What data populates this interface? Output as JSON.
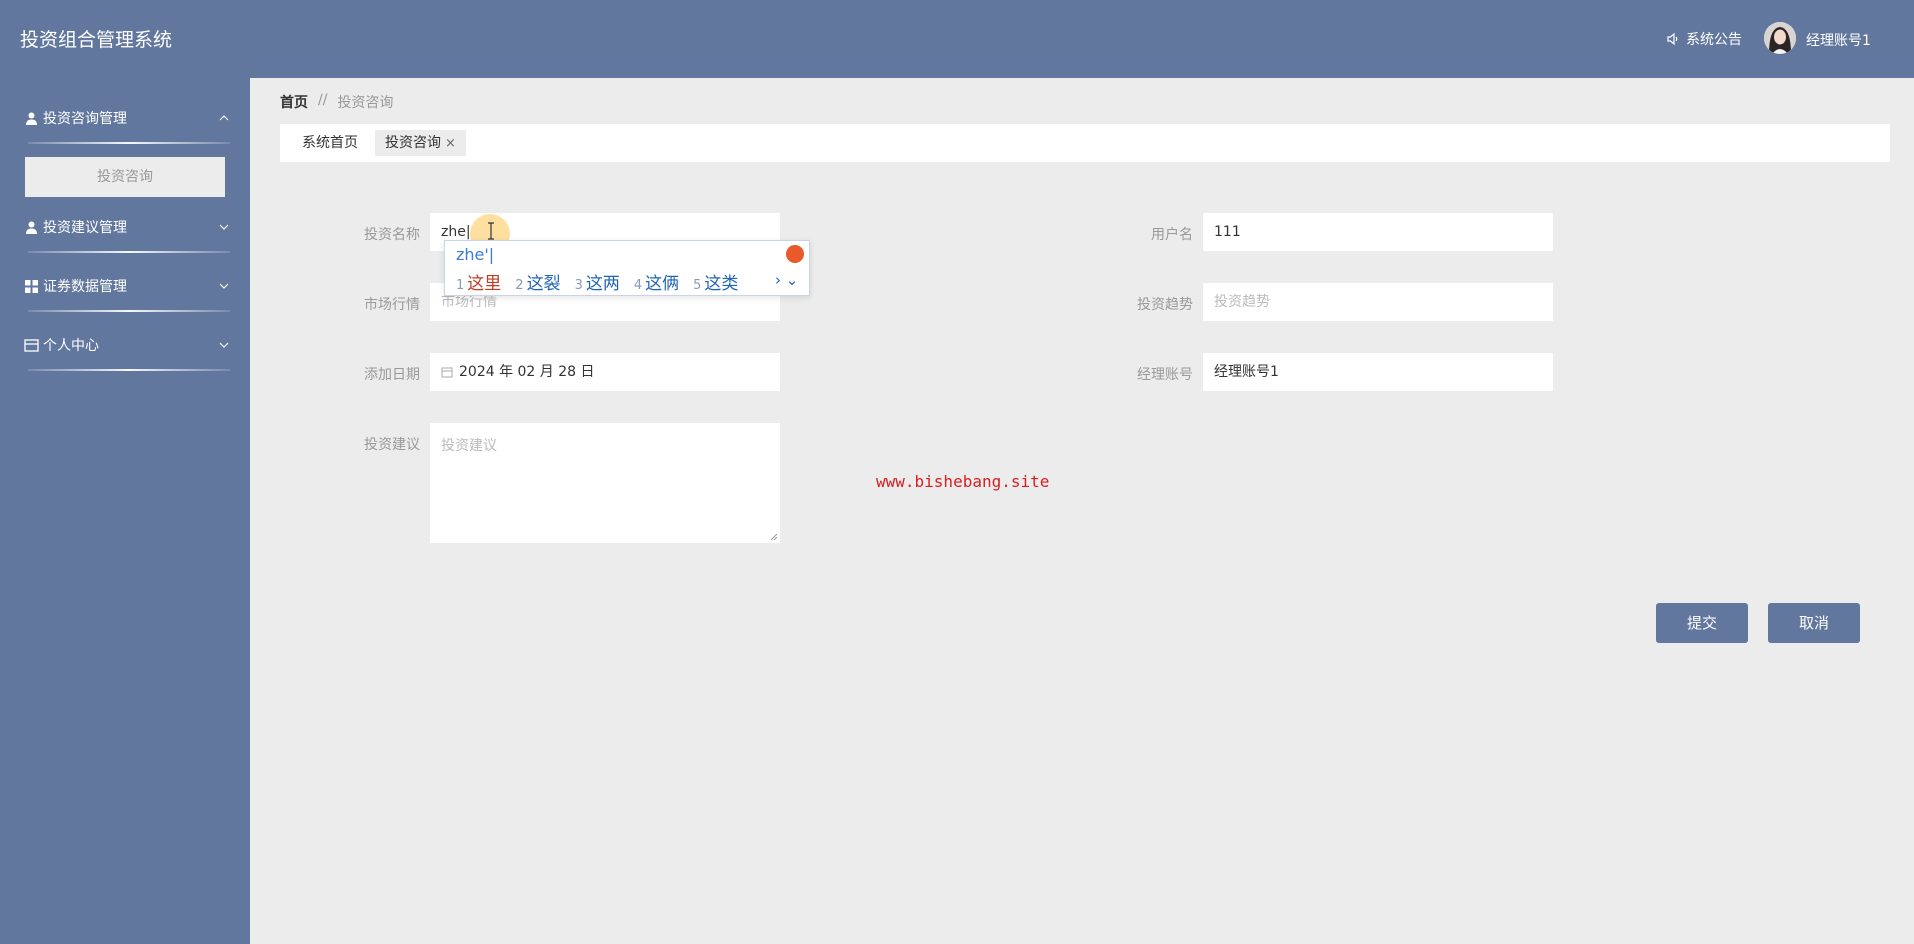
{
  "header": {
    "title": "投资组合管理系统",
    "notice_label": "系统公告",
    "username": "经理账号1"
  },
  "sidebar": {
    "groups": [
      {
        "label": "投资咨询管理",
        "icon": "user-icon",
        "expanded": true
      },
      {
        "label": "投资建议管理",
        "icon": "user-icon",
        "expanded": false
      },
      {
        "label": "证券数据管理",
        "icon": "grid-icon",
        "expanded": false
      },
      {
        "label": "个人中心",
        "icon": "card-icon",
        "expanded": false
      }
    ],
    "active_subitem": "投资咨询"
  },
  "breadcrumb": {
    "home": "首页",
    "separator": "//",
    "current": "投资咨询"
  },
  "tabs": [
    {
      "label": "系统首页"
    },
    {
      "label": "投资咨询",
      "close": "×"
    }
  ],
  "form": {
    "name": {
      "label": "投资名称",
      "value": "zhe|"
    },
    "username": {
      "label": "用户名",
      "value": "111"
    },
    "market": {
      "label": "市场行情",
      "placeholder": "市场行情"
    },
    "trend": {
      "label": "投资趋势",
      "placeholder": "投资趋势"
    },
    "date": {
      "label": "添加日期",
      "value": "2024 年 02 月 28 日"
    },
    "manager": {
      "label": "经理账号",
      "value": "经理账号1"
    },
    "advice": {
      "label": "投资建议",
      "placeholder": "投资建议"
    }
  },
  "ime": {
    "composition": "zhe'|",
    "candidates": [
      {
        "num": "1",
        "word": "这里"
      },
      {
        "num": "2",
        "word": "这裂"
      },
      {
        "num": "3",
        "word": "这两"
      },
      {
        "num": "4",
        "word": "这俩"
      },
      {
        "num": "5",
        "word": "这类"
      }
    ],
    "nav": "› ⌄"
  },
  "watermark": "www.bishebang.site",
  "buttons": {
    "submit": "提交",
    "cancel": "取消"
  },
  "colors": {
    "primary": "#62779e",
    "background": "#ececec",
    "watermark": "#d62020"
  }
}
